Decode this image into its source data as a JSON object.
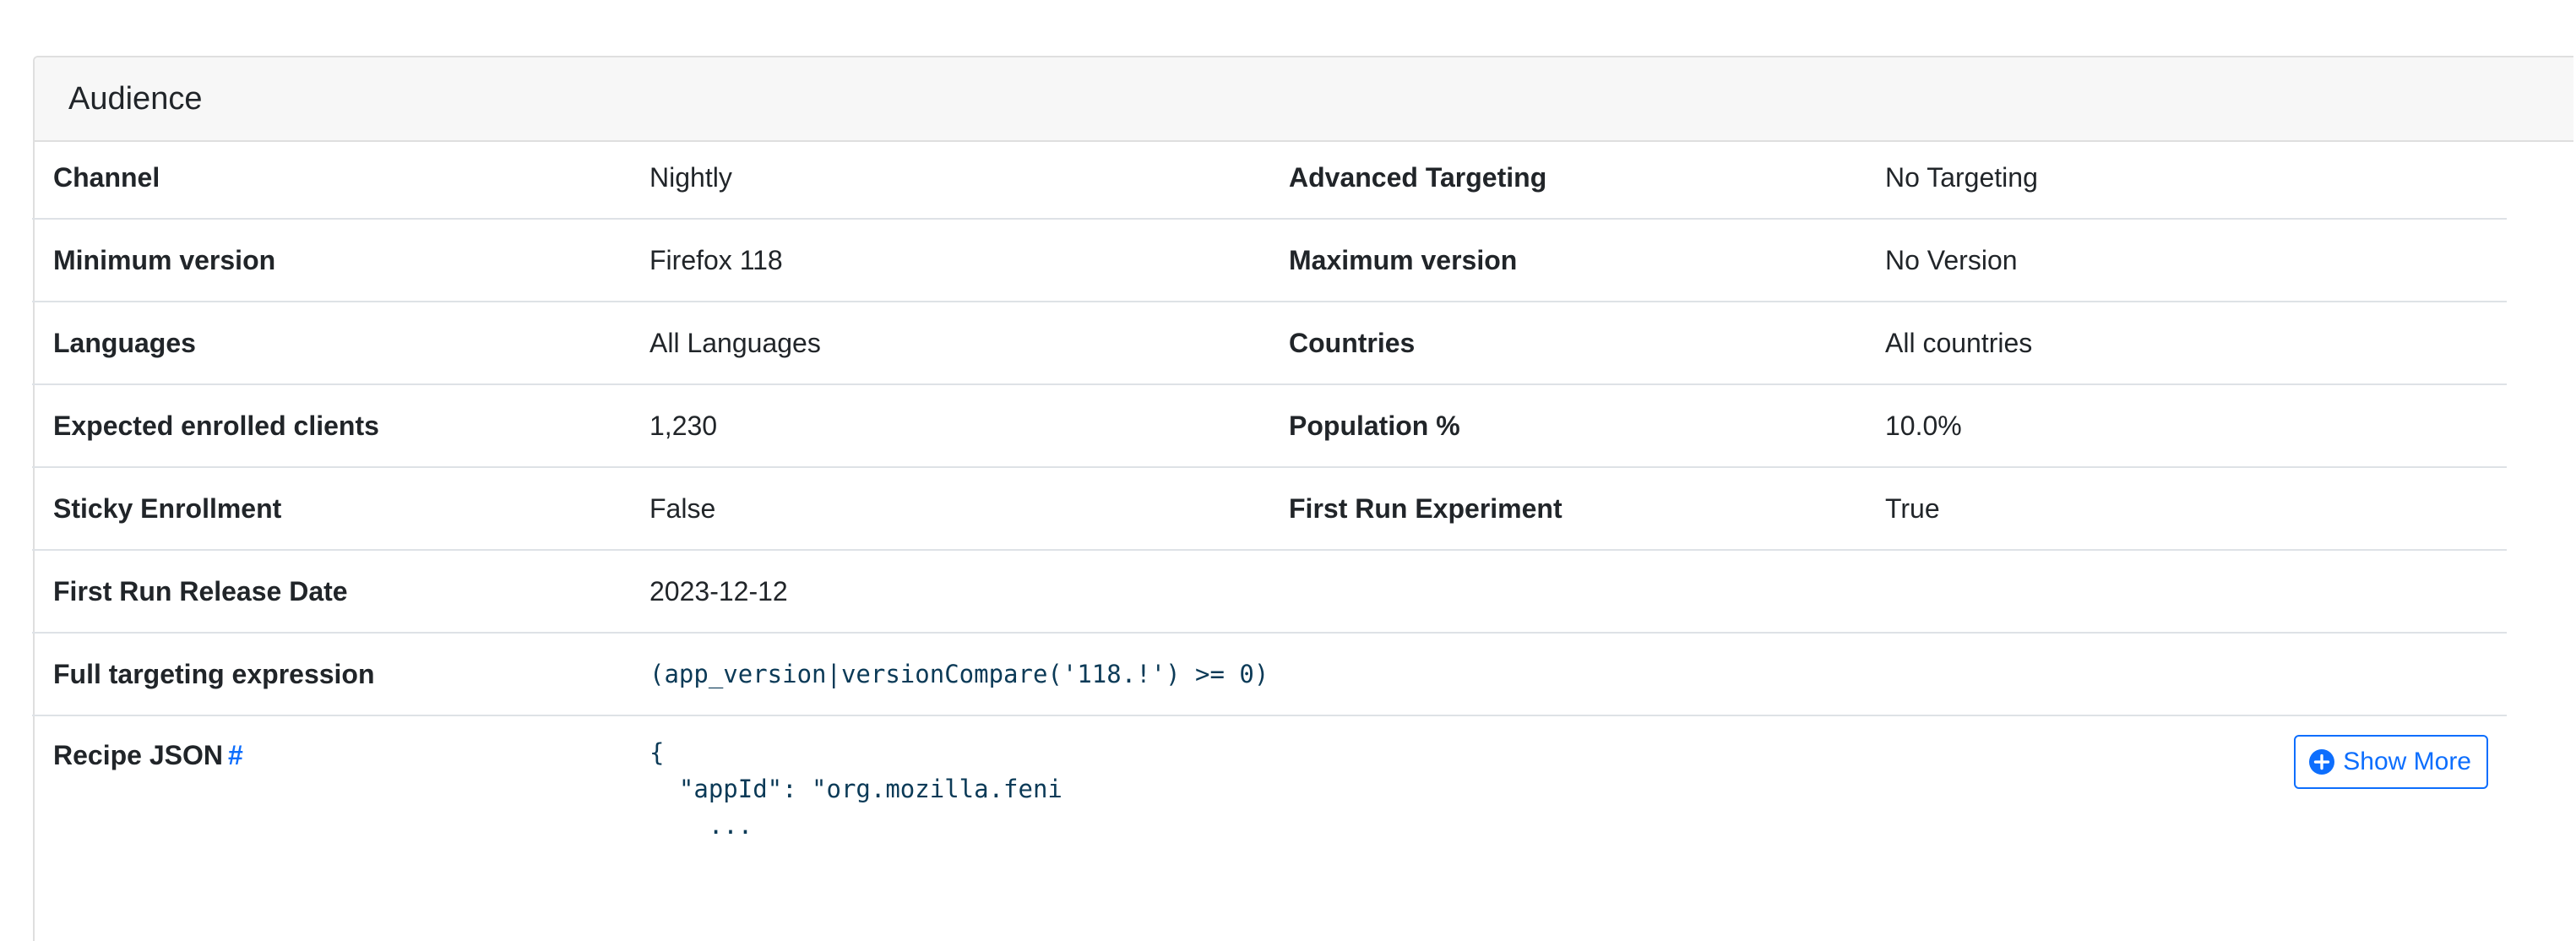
{
  "card": {
    "title": "Audience"
  },
  "rows": [
    {
      "label1": "Channel",
      "value1": "Nightly",
      "label2": "Advanced Targeting",
      "value2": "No Targeting"
    },
    {
      "label1": "Minimum version",
      "value1": "Firefox 118",
      "label2": "Maximum version",
      "value2": "No Version"
    },
    {
      "label1": "Languages",
      "value1": "All Languages",
      "label2": "Countries",
      "value2": "All countries"
    },
    {
      "label1": "Expected enrolled clients",
      "value1": "1,230",
      "label2": "Population %",
      "value2": "10.0%"
    },
    {
      "label1": "Sticky Enrollment",
      "value1": "False",
      "label2": "First Run Experiment",
      "value2": "True"
    },
    {
      "label1": "First Run Release Date",
      "value1": "2023-12-12"
    }
  ],
  "targeting": {
    "label": "Full targeting expression",
    "expression": "(app_version|versionCompare('118.!') >= 0)"
  },
  "recipe": {
    "label": "Recipe JSON",
    "anchor": "#",
    "json_preview": "{\n  \"appId\": \"org.mozilla.feni\n    ...",
    "show_more_label": "Show More",
    "show_more_icon": "plus-circle-icon"
  },
  "colors": {
    "accent": "#0d6efd",
    "code": "#0b3a57",
    "header_bg": "#f7f7f7",
    "border": "#dee2e6"
  }
}
